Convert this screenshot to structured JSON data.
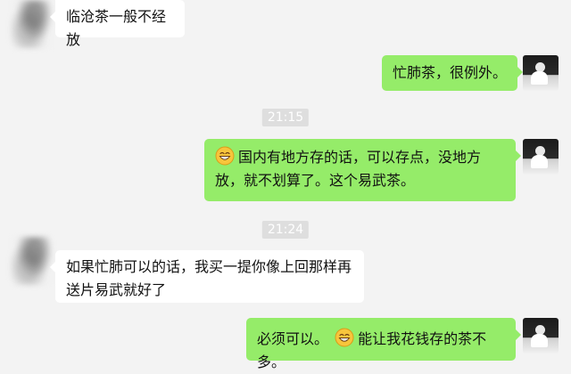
{
  "messages": [
    {
      "side": "in",
      "text": "临沧茶一般不经放"
    },
    {
      "side": "out",
      "text": "忙肺茶，很例外。"
    },
    {
      "timestamp": "21:15"
    },
    {
      "side": "out",
      "emoji": "grinning-face-icon",
      "text": "国内有地方存的话，可以存点，没地方放，就不划算了。这个易武茶。"
    },
    {
      "timestamp": "21:24"
    },
    {
      "side": "in",
      "text": "如果忙肺可以的话，我买一提你像上回那样再送片易武就好了"
    },
    {
      "side": "out",
      "prefix": "必须可以。",
      "emoji": "grinning-face-icon",
      "text": "能让我花钱存的茶不多。"
    }
  ],
  "colors": {
    "background": "#f3f3f3",
    "incoming_bubble": "#ffffff",
    "outgoing_bubble": "#95ec69",
    "timestamp_bg": "#dedede",
    "timestamp_text": "#ffffff"
  }
}
